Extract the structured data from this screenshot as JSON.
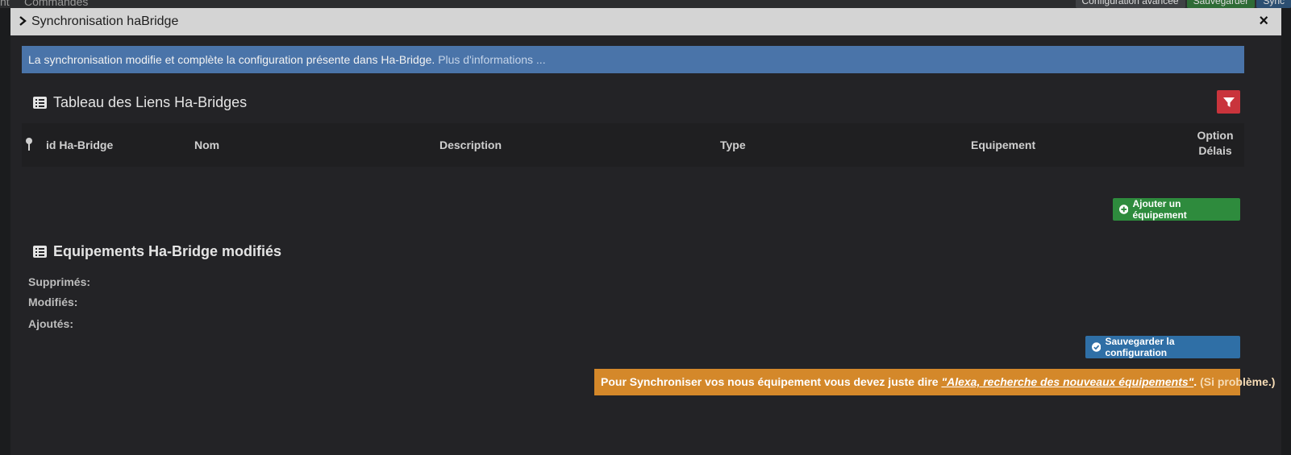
{
  "background": {
    "left_fragment": "nt",
    "tab_label": "Commandes",
    "buttons": [
      "Configuration avancée",
      "Sauvegarder",
      "Sync"
    ]
  },
  "modal": {
    "title": "Synchronisation haBridge",
    "close_symbol": "×"
  },
  "info_bar": {
    "text": "La synchronisation modifie et complète la configuration présente dans Ha-Bridge. ",
    "link": "Plus d'informations ..."
  },
  "links_table": {
    "title": "Tableau des Liens Ha-Bridges",
    "columns": [
      "id Ha-Bridge",
      "Nom",
      "Description",
      "Type",
      "Equipement",
      "Option",
      "Délais"
    ],
    "rows": []
  },
  "add_button": "Ajouter un équipement",
  "modified_section": {
    "title": "Equipements Ha-Bridge modifiés",
    "deleted_label": "Supprimés:",
    "modified_label": "Modifiés:",
    "added_label": "Ajoutés:"
  },
  "save_button": "Sauvegarder la configuration",
  "warning": {
    "text": "Pour Synchroniser vos nous équipement vous devez juste dire ",
    "quote": "\"Alexa, recherche des nouveaux équipements\"",
    "after": ". ",
    "link": "(Si problème.)"
  },
  "colors": {
    "info": "#4a74a9",
    "danger": "#c9343c",
    "success": "#2e8b3d",
    "primary": "#2f6fa6",
    "warning": "#d4882a"
  }
}
